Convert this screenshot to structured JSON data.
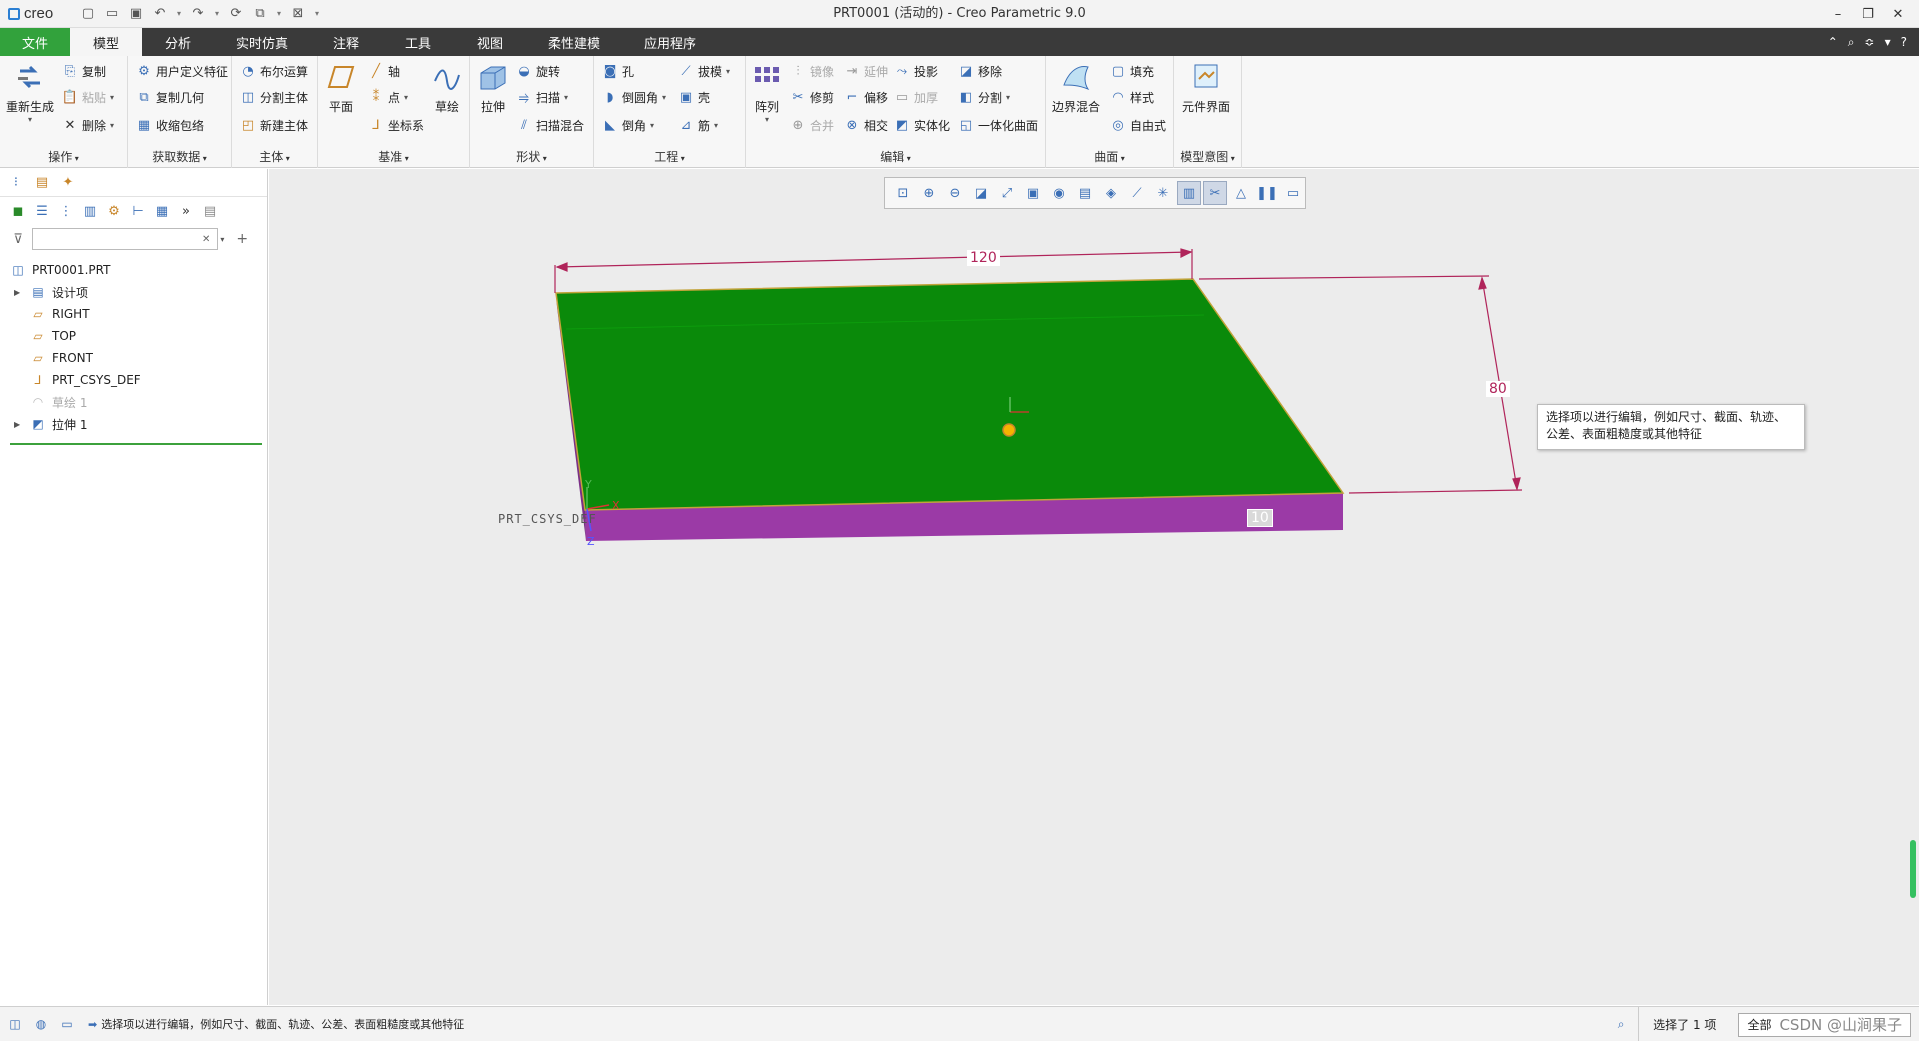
{
  "app": {
    "logo": "creo",
    "window_title": "PRT0001 (活动的) - Creo Parametric 9.0"
  },
  "tabs": [
    {
      "label": "文件"
    },
    {
      "label": "模型"
    },
    {
      "label": "分析"
    },
    {
      "label": "实时仿真"
    },
    {
      "label": "注释"
    },
    {
      "label": "工具"
    },
    {
      "label": "视图"
    },
    {
      "label": "柔性建模"
    },
    {
      "label": "应用程序"
    }
  ],
  "ribbon": {
    "ops": {
      "label": "操作",
      "regen": "重新生成",
      "copy": "复制",
      "paste": "粘贴",
      "delete": "删除"
    },
    "getdata": {
      "label": "获取数据",
      "udf": "用户定义特征",
      "copygeom": "复制几何",
      "shrinkwrap": "收缩包络"
    },
    "body": {
      "label": "主体",
      "boolean": "布尔运算",
      "split": "分割主体",
      "newbody": "新建主体"
    },
    "datum": {
      "label": "基准",
      "plane": "平面",
      "axis": "轴",
      "point": "点",
      "csys": "坐标系",
      "sketch": "草绘"
    },
    "shapes": {
      "label": "形状",
      "extrude": "拉伸",
      "revolve": "旋转",
      "sweep": "扫描",
      "sweepblend": "扫描混合"
    },
    "engineering": {
      "label": "工程",
      "hole": "孔",
      "draft": "拔模",
      "round": "倒圆角",
      "shell": "壳",
      "chamfer": "倒角",
      "rib": "筋"
    },
    "editing": {
      "label": "编辑",
      "pattern": "阵列",
      "mirror": "镜像",
      "extend": "延伸",
      "project": "投影",
      "trim": "修剪",
      "offset": "偏移",
      "thicken": "加厚",
      "merge": "合并",
      "intersect": "相交",
      "solidify": "实体化",
      "remove": "移除",
      "split": "分割",
      "unify": "一体化曲面"
    },
    "surfaces": {
      "label": "曲面",
      "boundary": "边界混合",
      "fill": "填充",
      "style": "样式",
      "freestyle": "自由式"
    },
    "intent": {
      "label": "模型意图",
      "component": "元件界面"
    }
  },
  "tree": {
    "search_placeholder": "",
    "items": [
      {
        "label": "PRT0001.PRT",
        "icon": "part-icon"
      },
      {
        "label": "设计项",
        "icon": "design-items-icon"
      },
      {
        "label": "RIGHT",
        "icon": "datum-plane-icon"
      },
      {
        "label": "TOP",
        "icon": "datum-plane-icon"
      },
      {
        "label": "FRONT",
        "icon": "datum-plane-icon"
      },
      {
        "label": "PRT_CSYS_DEF",
        "icon": "csys-icon"
      },
      {
        "label": "草绘 1",
        "icon": "sketch-icon"
      },
      {
        "label": "拉伸 1",
        "icon": "extrude-icon"
      }
    ]
  },
  "model": {
    "dim_length": "120",
    "dim_width": "80",
    "dim_thickness": "10",
    "csys_label": "PRT_CSYS_DEF",
    "axis_y": "Y",
    "axis_x": "X",
    "axis_z": "Z",
    "top_color": "#0a8a0a",
    "side_color": "#9b3aa6",
    "dim_color": "#b0245a"
  },
  "tooltip": {
    "text": "选择项以进行编辑，例如尺寸、截面、轨迹、公差、表面粗糙度或其他特征"
  },
  "status": {
    "message": "选择项以进行编辑，例如尺寸、截面、轨迹、公差、表面粗糙度或其他特征",
    "selection": "选择了 1 项",
    "filter": "全部",
    "watermark": "CSDN @山涧果子"
  }
}
